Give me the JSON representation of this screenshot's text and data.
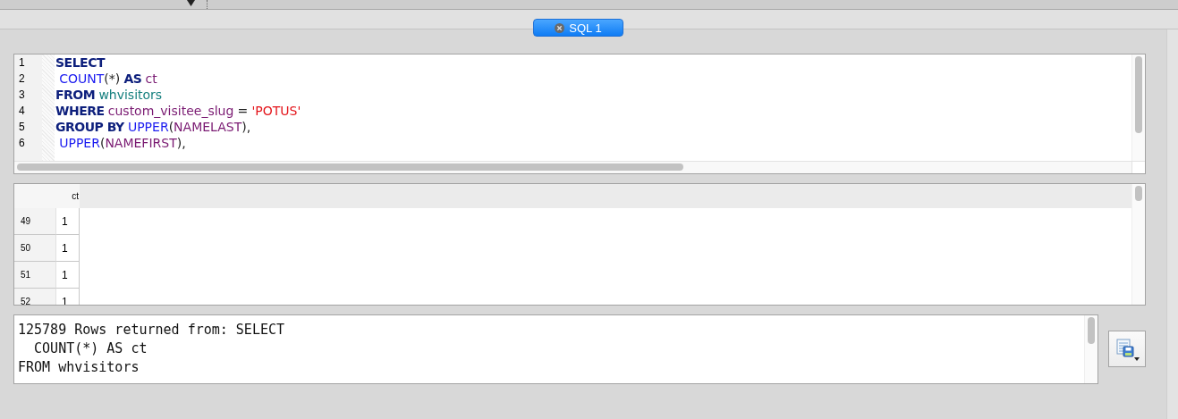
{
  "tab": {
    "label": "SQL 1",
    "selected": true
  },
  "editor": {
    "lines": [
      {
        "number": "1",
        "tokens": [
          {
            "kind": "keyword",
            "text": "SELECT"
          }
        ]
      },
      {
        "number": "2",
        "tokens": [
          {
            "kind": "function",
            "text": "COUNT",
            "space_before": true
          },
          {
            "kind": "punct",
            "text": "(*)"
          },
          {
            "kind": "keyword",
            "text": "AS",
            "space_before": true
          },
          {
            "kind": "identifier",
            "text": "ct",
            "space_before": true
          }
        ]
      },
      {
        "number": "3",
        "tokens": [
          {
            "kind": "keyword",
            "text": "FROM"
          },
          {
            "kind": "table",
            "text": "whvisitors",
            "space_before": true
          }
        ]
      },
      {
        "number": "4",
        "tokens": [
          {
            "kind": "keyword",
            "text": "WHERE"
          },
          {
            "kind": "identifier",
            "text": "custom_visitee_slug",
            "space_before": true
          },
          {
            "kind": "punct",
            "text": "=",
            "space_before": true
          },
          {
            "kind": "string",
            "text": "'POTUS'",
            "space_before": true
          }
        ]
      },
      {
        "number": "5",
        "tokens": [
          {
            "kind": "keyword",
            "text": "GROUP BY"
          },
          {
            "kind": "function",
            "text": "UPPER",
            "space_before": true
          },
          {
            "kind": "punct",
            "text": "("
          },
          {
            "kind": "identifier",
            "text": "NAMELAST"
          },
          {
            "kind": "punct",
            "text": "),"
          }
        ]
      },
      {
        "number": "6",
        "tokens": [
          {
            "kind": "function",
            "text": "UPPER",
            "space_before": true
          },
          {
            "kind": "punct",
            "text": "("
          },
          {
            "kind": "identifier",
            "text": "NAMEFIRST"
          },
          {
            "kind": "punct",
            "text": "),"
          }
        ]
      }
    ]
  },
  "results": {
    "columns": [
      "ct"
    ],
    "rows": [
      {
        "number": "49",
        "cells": [
          "1"
        ]
      },
      {
        "number": "50",
        "cells": [
          "1"
        ]
      },
      {
        "number": "51",
        "cells": [
          "1"
        ]
      },
      {
        "number": "52",
        "cells": [
          "1"
        ]
      }
    ]
  },
  "message": {
    "lines": [
      "125789 Rows returned from: SELECT",
      "  COUNT(*) AS ct",
      "FROM whvisitors"
    ]
  }
}
